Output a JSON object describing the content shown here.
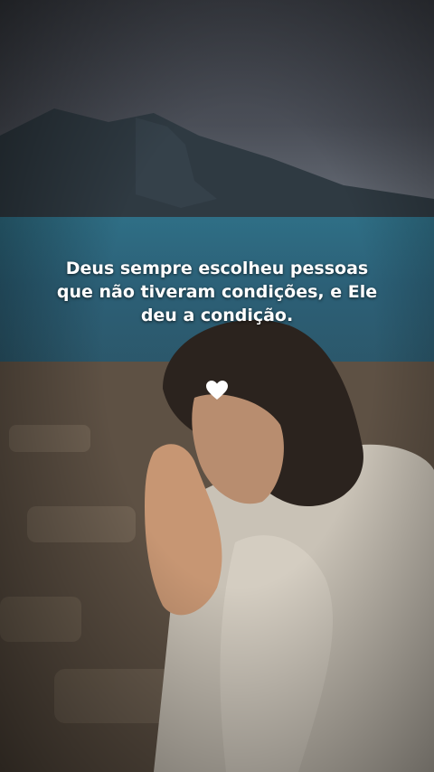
{
  "caption": {
    "text": "Deus sempre escolheu pessoas que não tiveram condições, e Ele deu a condição."
  },
  "heart_icon": {
    "icon": "white-heart-icon",
    "color": "#ffffff"
  }
}
